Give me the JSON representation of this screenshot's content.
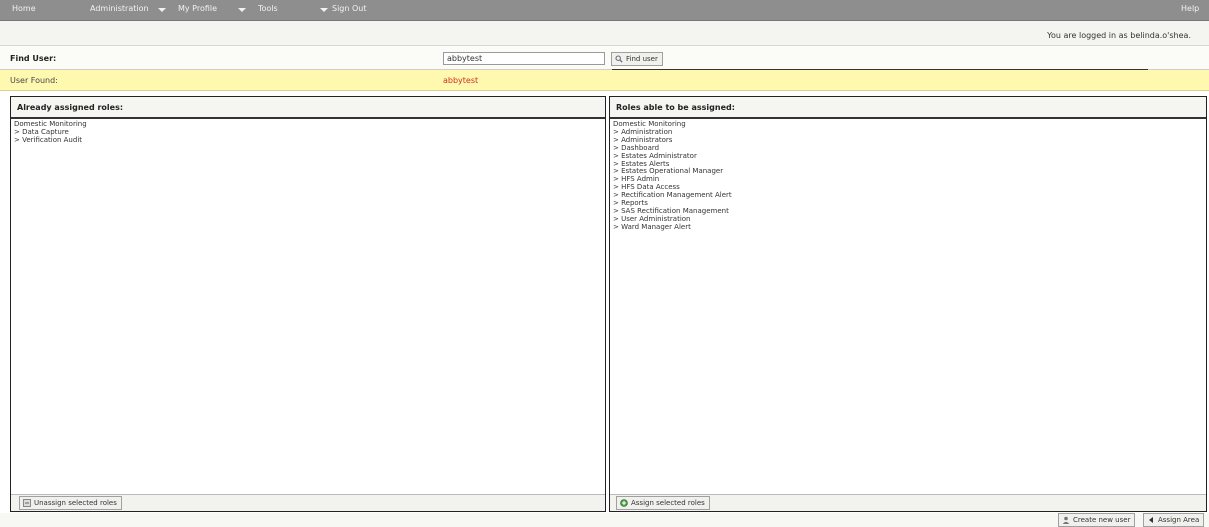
{
  "nav": {
    "home": "Home",
    "administration": "Administration",
    "my_profile": "My Profile",
    "tools": "Tools",
    "sign_out": "Sign Out",
    "help": "Help"
  },
  "session": {
    "logged_in_text": "You are logged in as belinda.o'shea."
  },
  "find": {
    "label": "Find User:",
    "value": "abbytest",
    "button": "Find user"
  },
  "found": {
    "label": "User Found:",
    "value": "abbytest"
  },
  "assigned": {
    "header": "Already assigned roles:",
    "group": "Domestic Monitoring",
    "roles": [
      "> Data Capture",
      "> Verification Audit"
    ],
    "button": "Unassign selected roles"
  },
  "available": {
    "header": "Roles able to be assigned:",
    "group": "Domestic Monitoring",
    "roles": [
      "> Administration",
      "> Administrators",
      "> Dashboard",
      "> Estates Administrator",
      "> Estates Alerts",
      "> Estates Operational Manager",
      "> HFS Admin",
      "> HFS Data Access",
      "> Rectification Management Alert",
      "> Reports",
      "> SAS Rectification Management",
      "> User Administration",
      "> Ward Manager Alert"
    ],
    "button": "Assign selected roles"
  },
  "actions": {
    "create_user": "Create new user",
    "assign_area": "Assign Area"
  },
  "icons": {
    "nav_dropdown": "chevron-down-icon",
    "find": "magnifier-icon",
    "unassign": "remove-icon",
    "assign": "add-icon",
    "create_user": "user-icon",
    "assign_area": "arrow-left-icon"
  }
}
